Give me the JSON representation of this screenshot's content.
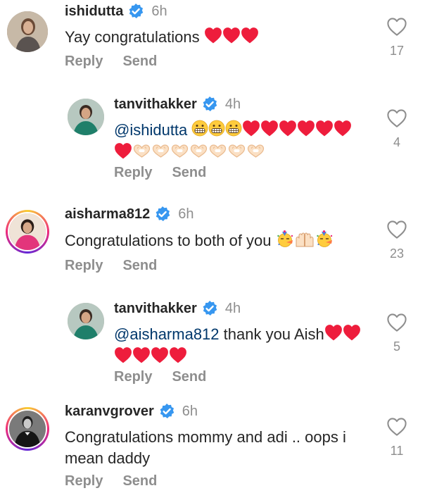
{
  "comments": [
    {
      "username": "ishidutta",
      "time": "6h",
      "text": "Yay congratulations",
      "reply_label": "Reply",
      "send_label": "Send",
      "likes": "17"
    },
    {
      "username": "tanvithakker",
      "time": "4h",
      "mention": "@ishidutta",
      "reply_label": "Reply",
      "send_label": "Send",
      "likes": "4"
    },
    {
      "username": "aisharma812",
      "time": "6h",
      "text": "Congratulations to both of you",
      "reply_label": "Reply",
      "send_label": "Send",
      "likes": "23"
    },
    {
      "username": "tanvithakker",
      "time": "4h",
      "mention": "@aisharma812",
      "text": " thank you Aish",
      "reply_label": "Reply",
      "send_label": "Send",
      "likes": "5"
    },
    {
      "username": "karanvgrover",
      "time": "6h",
      "text_line1": "Congratulations mommy and adi .. oops i",
      "text_line2": "mean daddy",
      "reply_label": "Reply",
      "send_label": "Send",
      "likes": "11"
    }
  ],
  "colors": {
    "verified": "#3797f0",
    "heart_emoji": "#ee1d3c",
    "muted": "#8e8e8e",
    "mention": "#00376b"
  },
  "icons": {
    "verified": "verified-badge-icon",
    "like": "heart-outline-icon"
  }
}
